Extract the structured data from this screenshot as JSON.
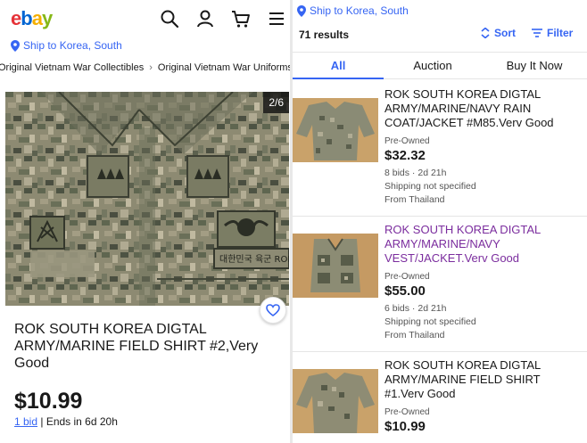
{
  "left": {
    "logo": {
      "letters": [
        "e",
        "b",
        "a",
        "y"
      ],
      "colors": [
        "#e53238",
        "#0064d2",
        "#f5af02",
        "#86b817"
      ]
    },
    "icons": [
      "search-icon",
      "user-icon",
      "cart-icon",
      "menu-icon"
    ],
    "ship_to": "Ship to Korea, South",
    "breadcrumb": [
      "Original Vietnam War Collectibles",
      "Original Vietnam War Uniforms"
    ],
    "image_counter": "2/6",
    "title": "ROK SOUTH KOREA DIGTAL ARMY/MARINE FIELD SHIRT #2,Very Good",
    "price": "$10.99",
    "bids": "1 bid",
    "ends": "| Ends in 6d 20h"
  },
  "right": {
    "ship_to": "Ship to Korea, South",
    "results_count": "71 results",
    "sort_label": "Sort",
    "filter_label": "Filter",
    "tabs": [
      {
        "label": "All",
        "active": true
      },
      {
        "label": "Auction",
        "active": false
      },
      {
        "label": "Buy It Now",
        "active": false
      }
    ],
    "listings": [
      {
        "title": "ROK SOUTH KOREA DIGTAL ARMY/MARINE/NAVY RAIN COAT/JACKET #M85.Verv Good",
        "condition": "Pre-Owned",
        "price": "$32.32",
        "bids": "8 bids · 2d 21h",
        "shipping": "Shipping not specified",
        "origin": "From Thailand",
        "visited": false
      },
      {
        "title": "ROK SOUTH KOREA DIGTAL ARMY/MARINE/NAVY VEST/JACKET.Verv Good",
        "condition": "Pre-Owned",
        "price": "$55.00",
        "bids": "6 bids · 2d 21h",
        "shipping": "Shipping not specified",
        "origin": "From Thailand",
        "visited": true
      },
      {
        "title": "ROK SOUTH KOREA DIGTAL ARMY/MARINE FIELD SHIRT #1.Verv Good",
        "condition": "Pre-Owned",
        "price": "$10.99",
        "bids": "",
        "shipping": "",
        "origin": "",
        "visited": false
      }
    ]
  },
  "colors": {
    "accent": "#3665f3",
    "visited": "#7b2d9e"
  }
}
